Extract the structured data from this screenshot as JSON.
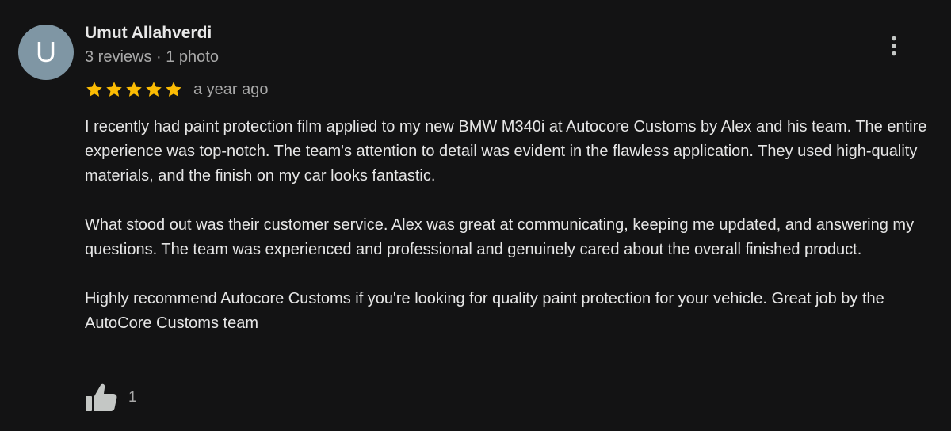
{
  "review": {
    "author": {
      "initial": "U",
      "name": "Umut Allahverdi",
      "meta": "3 reviews · 1 photo",
      "avatar_color": "#7f96a4"
    },
    "more_icon": "vertical-dots-icon",
    "rating": {
      "value": 5,
      "max": 5,
      "star_color": "#fbbc04"
    },
    "date": "a year ago",
    "paragraphs": [
      "I recently had paint protection film applied to my new BMW M340i at Autocore Customs by Alex and his team. The entire experience was top-notch. The team's attention to detail was evident in the flawless application. They used high-quality materials, and the finish on my car looks fantastic.",
      "What stood out was their customer service. Alex was great at communicating, keeping me updated, and answering my questions. The team was experienced and professional and genuinely cared about the overall finished product.",
      "Highly recommend Autocore Customs if you're looking for quality paint protection for your vehicle. Great job by the AutoCore Customs team"
    ],
    "like": {
      "icon": "thumbs-up-icon",
      "count": "1"
    }
  }
}
